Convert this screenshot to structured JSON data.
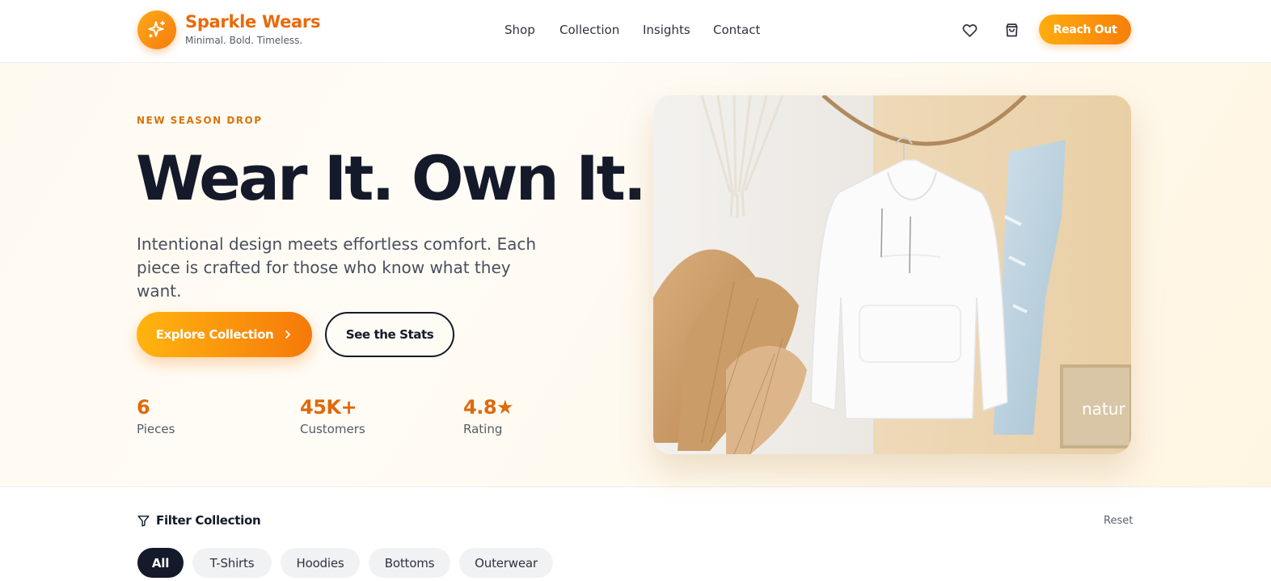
{
  "header": {
    "brand_name": "Sparkle Wears",
    "brand_tagline": "Minimal. Bold. Timeless.",
    "nav": [
      "Shop",
      "Collection",
      "Insights",
      "Contact"
    ],
    "cta_label": "Reach Out",
    "icons": [
      "sparkle-icon",
      "heart-icon",
      "shopping-bag-icon"
    ]
  },
  "hero": {
    "eyebrow": "NEW SEASON DROP",
    "headline": "Wear It. Own It.",
    "subtext": "Intentional design meets effortless comfort. Each piece is crafted for those who know what they want.",
    "primary_button": "Explore Collection",
    "secondary_button": "See the Stats",
    "stats": [
      {
        "value": "6",
        "label": "Pieces"
      },
      {
        "value": "45K+",
        "label": "Customers"
      },
      {
        "value": "4.8★",
        "label": "Rating"
      }
    ],
    "image_text": "natur"
  },
  "filter": {
    "title": "Filter Collection",
    "reset_label": "Reset",
    "chips": [
      "All",
      "T-Shirts",
      "Hoodies",
      "Bottoms",
      "Outerwear"
    ],
    "active_chip": "All"
  },
  "colors": {
    "accent": "#f57c0b",
    "accent_light": "#ffad0f",
    "dark": "#141a2a"
  }
}
